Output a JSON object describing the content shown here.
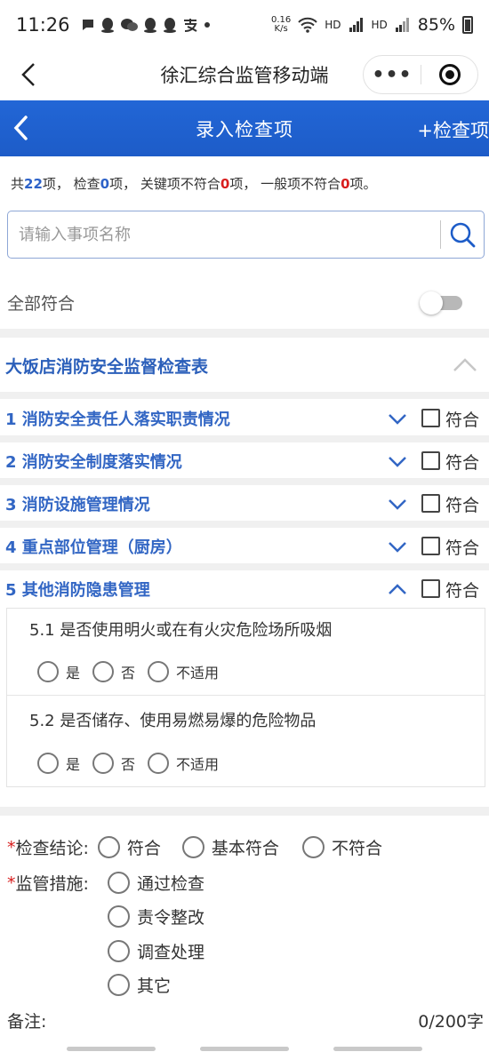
{
  "status_bar": {
    "time": "11:26",
    "net_speed_value": "0.16",
    "net_speed_unit": "K/s",
    "hd1": "HD",
    "hd2": "HD",
    "battery": "85%"
  },
  "mini_program": {
    "title": "徐汇综合监管移动端",
    "more_label": "•••"
  },
  "page": {
    "title": "录入检查项",
    "add_item": "+检查项"
  },
  "summary": {
    "prefix": "共",
    "total": "22",
    "t1": "项， 检查",
    "checked": "0",
    "t2": "项， 关键项不符合",
    "key_fail": "0",
    "t3": "项， 一般项不符合",
    "general_fail": "0",
    "t4": "项。"
  },
  "search": {
    "placeholder": "请输入事项名称",
    "value": ""
  },
  "all_conform": {
    "label": "全部符合",
    "on": false
  },
  "form": {
    "title": "大饭店消防安全监督检查表",
    "expanded": true,
    "check_label": "符合",
    "sections": [
      {
        "title": "1 消防安全责任人落实职责情况",
        "expanded": false,
        "checked": false
      },
      {
        "title": "2 消防安全制度落实情况",
        "expanded": false,
        "checked": false
      },
      {
        "title": "3 消防设施管理情况",
        "expanded": false,
        "checked": false
      },
      {
        "title": "4 重点部位管理（厨房）",
        "expanded": false,
        "checked": false
      },
      {
        "title": "5 其他消防隐患管理",
        "expanded": true,
        "checked": false
      }
    ],
    "items": [
      {
        "question": "5.1  是否使用明火或在有火灾危险场所吸烟",
        "options": [
          "是",
          "否",
          "不适用"
        ]
      },
      {
        "question": "5.2  是否储存、使用易燃易爆的危险物品",
        "options": [
          "是",
          "否",
          "不适用"
        ]
      }
    ]
  },
  "conclusion": {
    "required_mark": "*",
    "label": "检查结论:",
    "options": [
      "符合",
      "基本符合",
      "不符合"
    ]
  },
  "measures": {
    "required_mark": "*",
    "label": "监管措施:",
    "options": [
      "通过检查",
      "责令整改",
      "调查处理",
      "其它"
    ]
  },
  "remark": {
    "label": "备注:",
    "count": "0/200字"
  },
  "colors": {
    "primary": "#1d5cc8",
    "section_title": "#3266c4",
    "highlight_red": "#d81e1e"
  }
}
